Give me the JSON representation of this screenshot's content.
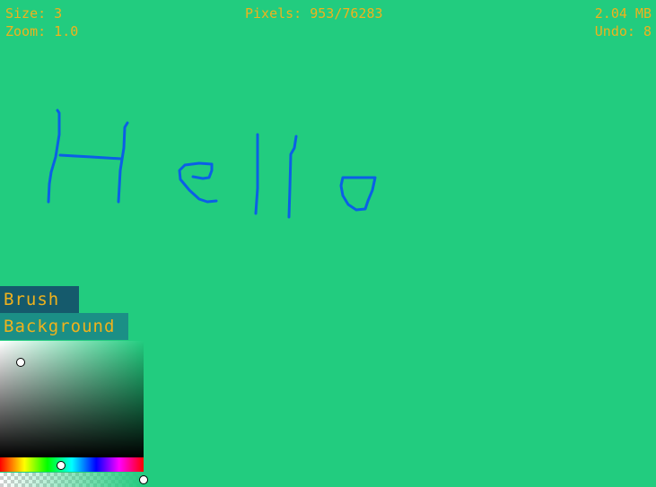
{
  "hud": {
    "size": "Size: 3",
    "zoom": "Zoom: 1.0",
    "pixels": "Pixels: 953/76283",
    "memory": "2.04 MB",
    "undo": "Undo: 8"
  },
  "canvas": {
    "background_color": "#22cc7f",
    "stroke_color": "#0b5fe6",
    "drawn_text": "Hello"
  },
  "color_tabs": {
    "brush": "Brush",
    "background": "Background"
  },
  "color_picker": {
    "hue_color": "#22cc7f",
    "alpha_level": 1.0
  },
  "colors": {
    "hud_text": "#f0b21c",
    "brush_tab_bg": "#155a6c",
    "background_tab_bg": "#1b8f86"
  }
}
